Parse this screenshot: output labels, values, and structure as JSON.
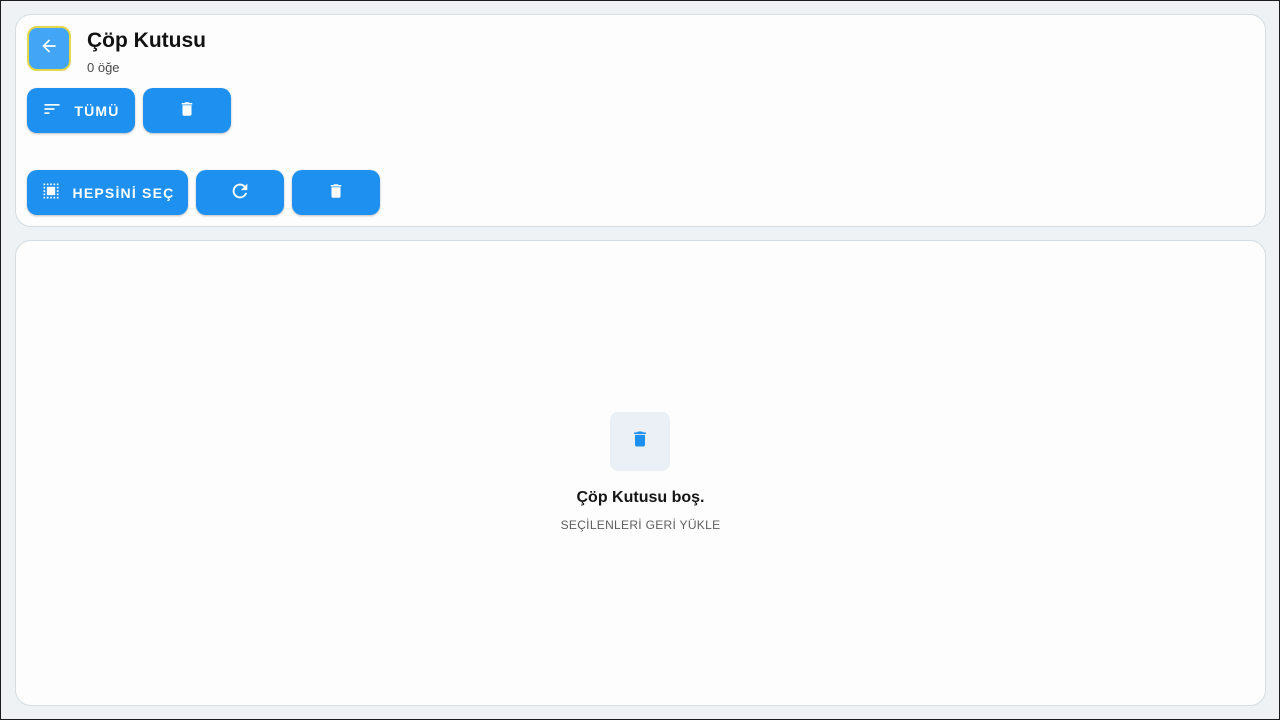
{
  "header": {
    "title": "Çöp Kutusu",
    "item_count": "0 öğe",
    "back_icon": "arrow-left-icon"
  },
  "toolbar_top": {
    "filter_label": "TÜMÜ",
    "filter_icon": "sort-lines-icon",
    "delete_icon": "trash-icon"
  },
  "toolbar_selection": {
    "select_all_label": "HEPSİNİ SEÇ",
    "select_all_icon": "select-all-icon",
    "restore_icon": "refresh-icon",
    "delete_icon": "trash-icon"
  },
  "empty_state": {
    "icon": "trash-icon",
    "title": "Çöp Kutusu boş.",
    "subtitle": "SEÇİLENLERİ GERİ YÜKLE"
  },
  "colors": {
    "accent": "#1e90f0",
    "back_button": "#42a5f5",
    "background": "#eef2f5",
    "card": "#fdfdfd"
  }
}
